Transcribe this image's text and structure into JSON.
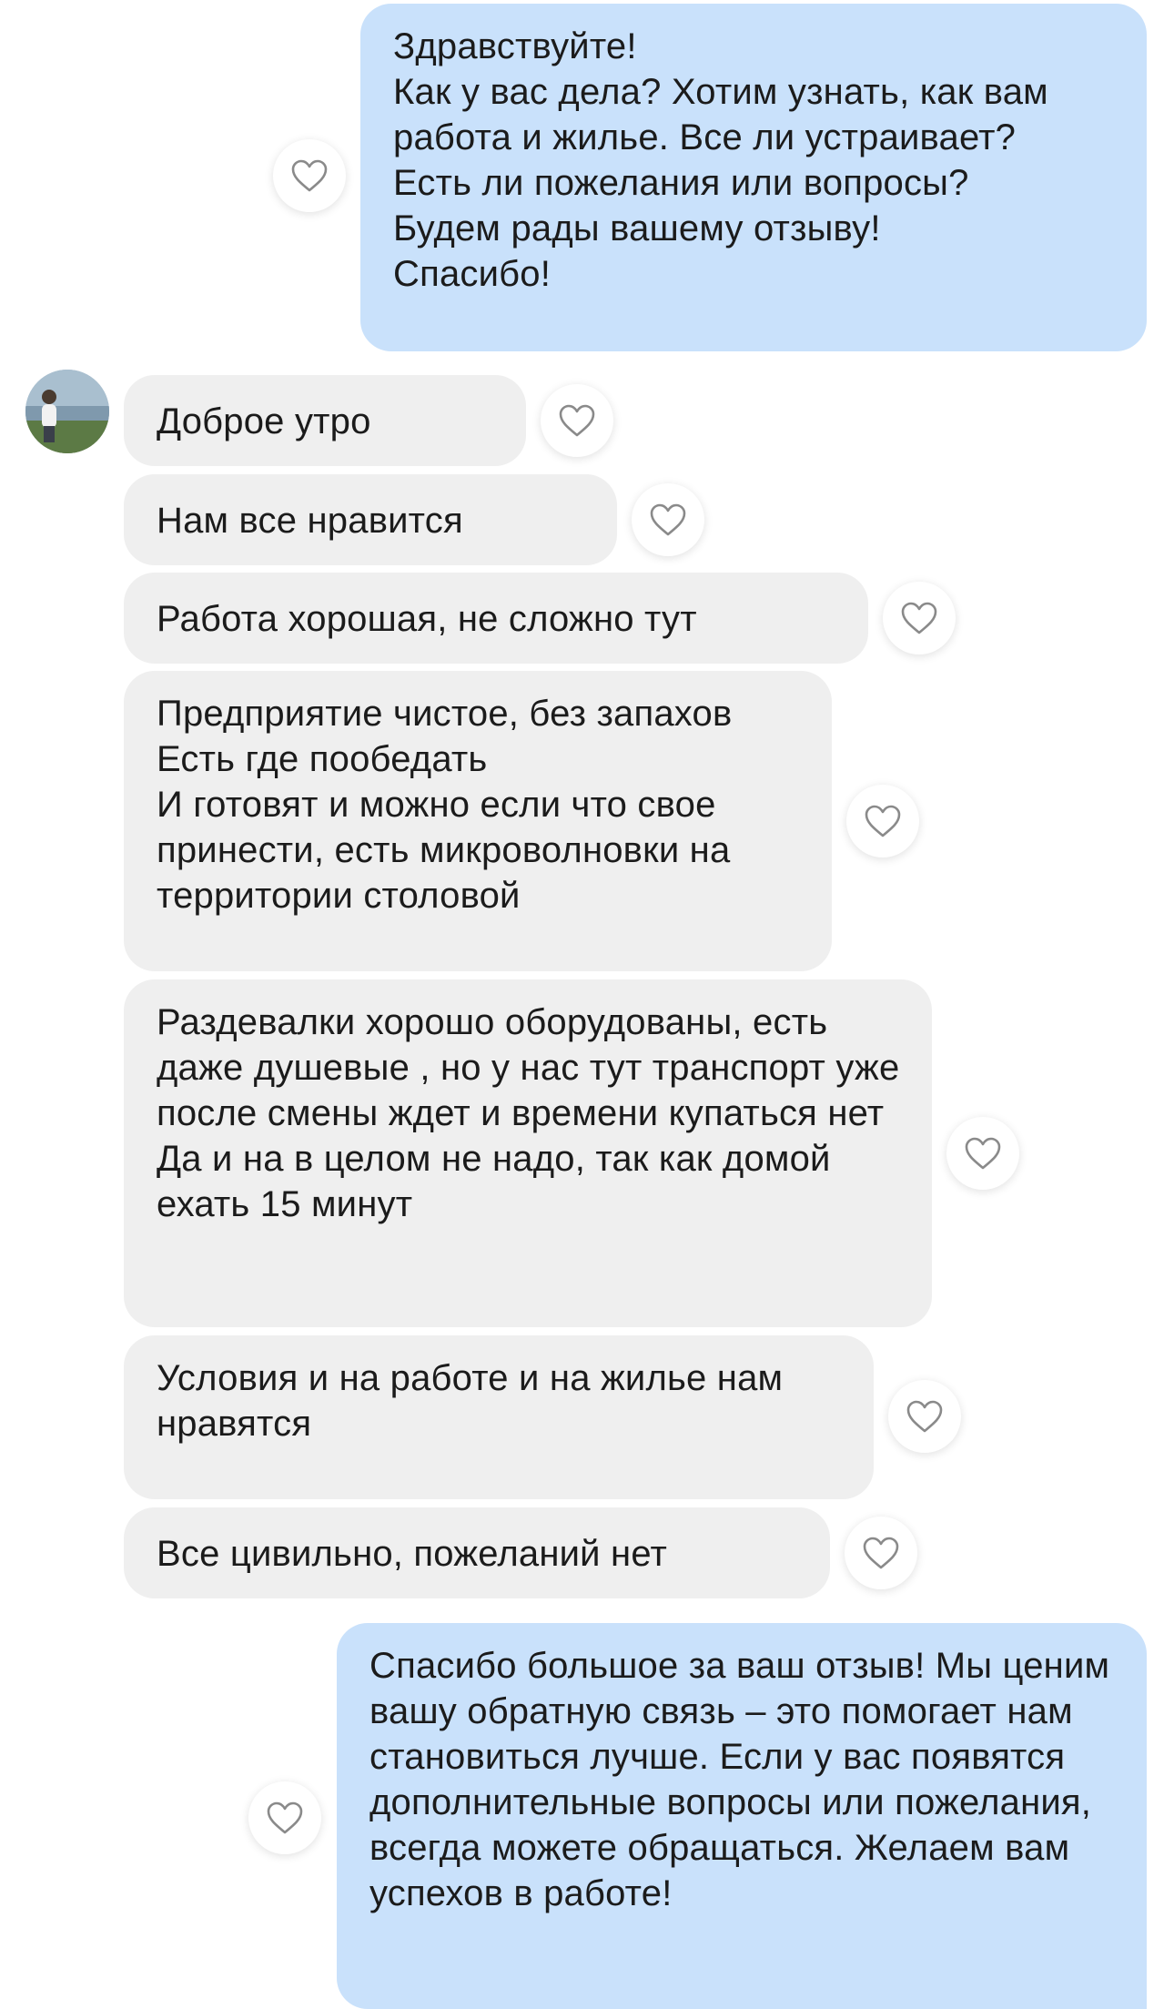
{
  "messages": [
    {
      "id": "m1",
      "direction": "outgoing",
      "text": "Здравствуйте!\nКак у вас дела? Хотим узнать, как вам работа и жилье. Все ли устраивает?\nЕсть ли пожелания или вопросы?\nБудем рады вашему отзыву!\nСпасибо!"
    },
    {
      "id": "m2",
      "direction": "incoming",
      "text": "Доброе утро"
    },
    {
      "id": "m3",
      "direction": "incoming",
      "text": "Нам все нравится"
    },
    {
      "id": "m4",
      "direction": "incoming",
      "text": "Работа хорошая, не сложно тут"
    },
    {
      "id": "m5",
      "direction": "incoming",
      "text": "Предприятие чистое, без запахов\nЕсть где пообедать\nИ готовят и можно если что свое принести, есть микроволновки на территории столовой"
    },
    {
      "id": "m6",
      "direction": "incoming",
      "text": "Раздевалки хорошо оборудованы, есть даже душевые , но у нас тут транспорт уже после смены ждет и времени купаться нет\nДа и на в целом не надо, так как домой ехать 15 минут"
    },
    {
      "id": "m7",
      "direction": "incoming",
      "text": "Условия и на работе и на жилье нам нравятся"
    },
    {
      "id": "m8",
      "direction": "incoming",
      "text": "Все цивильно, пожеланий нет"
    },
    {
      "id": "m9",
      "direction": "outgoing",
      "text": "Спасибо большое за ваш отзыв! Мы ценим вашу обратную связь – это помогает нам становиться лучше. Если у вас появятся дополнительные вопросы или пожелания, всегда можете обращаться. Желаем вам успехов в работе!"
    }
  ],
  "icons": {
    "like": "heart-outline-icon",
    "avatar": "contact-avatar"
  },
  "colors": {
    "outgoing_bubble": "#c9e1fb",
    "incoming_bubble": "#efefef",
    "text": "#1b1b1b",
    "heart_stroke": "#8a8a8a",
    "background": "#ffffff"
  }
}
